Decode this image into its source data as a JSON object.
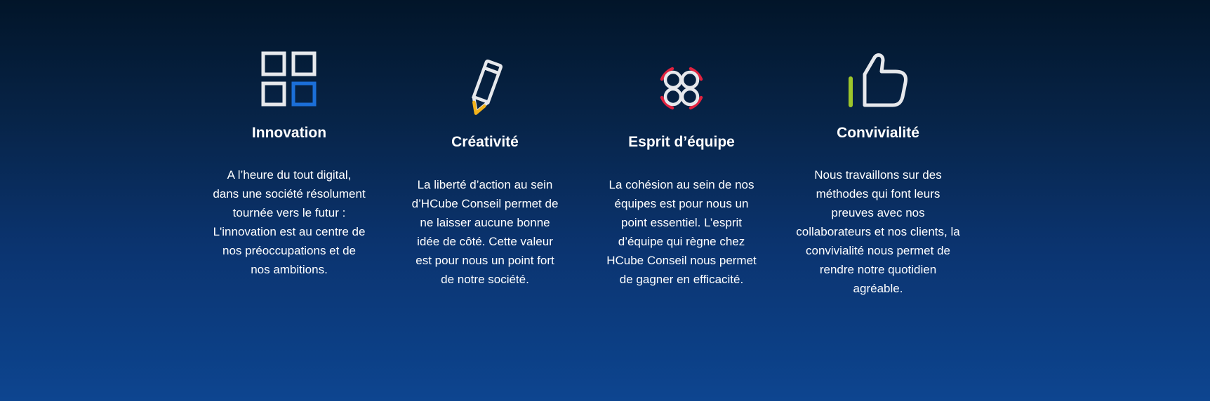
{
  "values": [
    {
      "icon": "grid-squares-icon",
      "title": "Innovation",
      "text": "A l’heure du tout digital, dans une société résolument tournée vers le futur : L'innovation est au centre de nos préoccupations et de nos ambitions."
    },
    {
      "icon": "pencil-icon",
      "title": "Créativité",
      "text": "La liberté d’action au sein d’HCube Conseil permet de ne laisser aucune bonne idée de côté. Cette valeur est pour nous un point fort de notre société."
    },
    {
      "icon": "team-circles-icon",
      "title": "Esprit d’équipe",
      "text": "La cohésion au sein de nos équipes est pour nous un point essentiel. L’esprit d’équipe qui règne chez HCube Conseil nous permet de gagner en efficacité."
    },
    {
      "icon": "thumbs-up-icon",
      "title": "Convivialité",
      "text": "Nous travaillons sur des méthodes qui font leurs preuves avec nos collaborateurs et nos clients, la convivialité nous permet de rendre notre quotidien agréable."
    }
  ],
  "colors": {
    "icon_stroke": "#e6e8ec",
    "accent_blue": "#1b6fd8",
    "accent_yellow": "#f2b21b",
    "accent_red": "#e0223f",
    "accent_green": "#9dc62b"
  }
}
